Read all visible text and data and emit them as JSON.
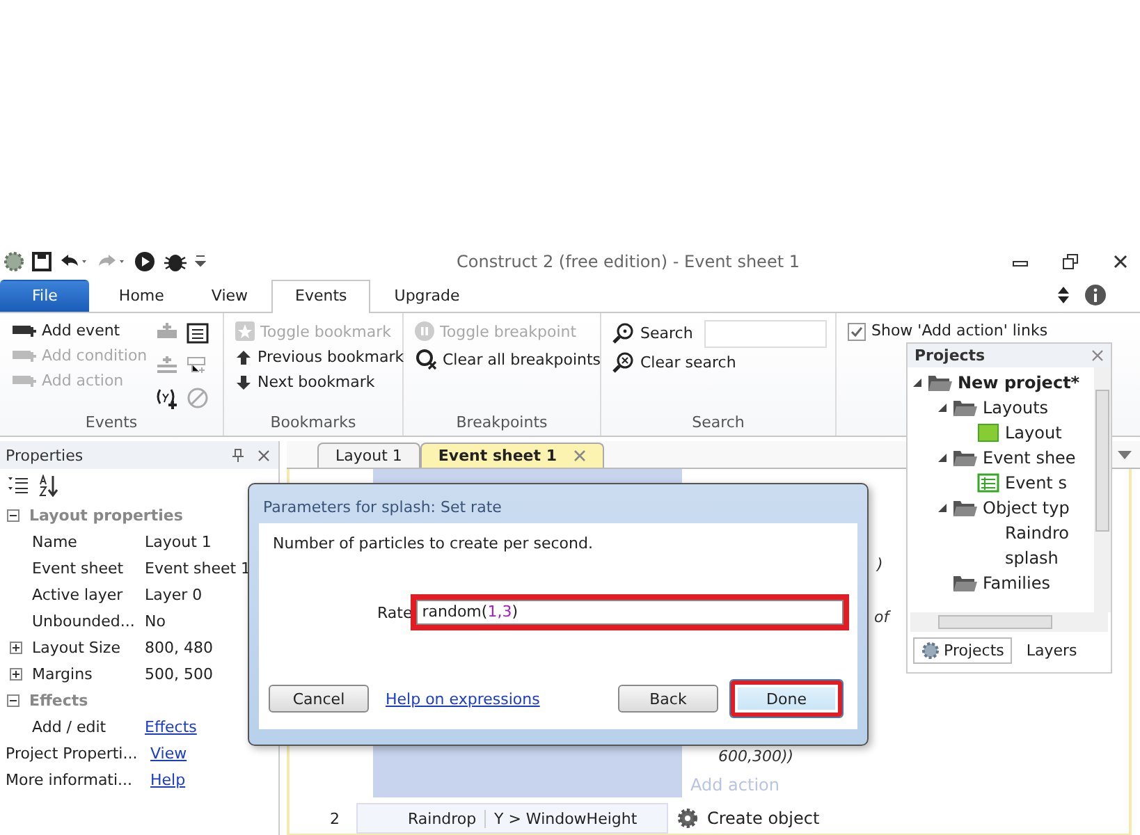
{
  "window": {
    "title": "Construct 2  (free edition) - Event sheet 1"
  },
  "ribbon_tabs": [
    {
      "label": "File",
      "kind": "file",
      "selected": false
    },
    {
      "label": "Home",
      "kind": "tab",
      "selected": false
    },
    {
      "label": "View",
      "kind": "tab",
      "selected": false
    },
    {
      "label": "Events",
      "kind": "tab",
      "selected": true
    },
    {
      "label": "Upgrade",
      "kind": "tab",
      "selected": false
    }
  ],
  "ribbon_groups": [
    {
      "label": "Events",
      "items": [
        {
          "label": "Add event",
          "disabled": false
        },
        {
          "label": "Add condition",
          "disabled": true
        },
        {
          "label": "Add action",
          "disabled": true
        }
      ]
    },
    {
      "label": "Bookmarks",
      "items": [
        {
          "label": "Toggle bookmark",
          "disabled": true
        },
        {
          "label": "Previous bookmark",
          "disabled": false
        },
        {
          "label": "Next bookmark",
          "disabled": false
        }
      ]
    },
    {
      "label": "Breakpoints",
      "items": [
        {
          "label": "Toggle breakpoint",
          "disabled": true
        },
        {
          "label": "Clear all breakpoints",
          "disabled": false
        }
      ]
    },
    {
      "label": "Search",
      "items": [
        {
          "label": "Search",
          "disabled": false
        },
        {
          "label": "Clear search",
          "disabled": false
        }
      ]
    }
  ],
  "show_add_action_links": {
    "label": "Show 'Add action' links",
    "checked": true
  },
  "properties": {
    "title": "Properties",
    "sections": [
      {
        "label": "Layout properties",
        "expanded": true,
        "rows": [
          {
            "name": "Name",
            "value": "Layout 1",
            "kind": "plain"
          },
          {
            "name": "Event sheet",
            "value": "Event sheet 1",
            "kind": "plain"
          },
          {
            "name": "Active layer",
            "value": "Layer 0",
            "kind": "plain"
          },
          {
            "name": "Unbounded...",
            "value": "No",
            "kind": "plain"
          },
          {
            "name": "Layout Size",
            "value": "800, 480",
            "kind": "expandable"
          },
          {
            "name": "Margins",
            "value": "500, 500",
            "kind": "expandable"
          }
        ]
      },
      {
        "label": "Effects",
        "expanded": true,
        "rows": [
          {
            "name": "Add / edit",
            "value": "Effects",
            "kind": "link"
          }
        ]
      }
    ],
    "footer_rows": [
      {
        "name": "Project Properti...",
        "value": "View",
        "kind": "link"
      },
      {
        "name": "More informati...",
        "value": "Help",
        "kind": "link"
      }
    ]
  },
  "editor_tabs": [
    {
      "label": "Layout 1",
      "selected": false
    },
    {
      "label": "Event sheet 1",
      "selected": true
    }
  ],
  "event_sheet": {
    "action_fragments": [
      ")",
      "of",
      "600,300))"
    ],
    "add_action": "Add action",
    "event_2": {
      "number": "2",
      "object": "Raindrop",
      "condition": "Y > WindowHeight",
      "action": "Create object"
    }
  },
  "dialog": {
    "title": "Parameters for splash: Set rate",
    "description": "Number of particles to create per second.",
    "param_label": "Rate",
    "value": [
      {
        "text": "random(",
        "kind": "plain"
      },
      {
        "text": "1,3",
        "kind": "number"
      },
      {
        "text": ")",
        "kind": "plain"
      }
    ],
    "field_highlighted": true,
    "help_link": "Help on expressions",
    "buttons": [
      {
        "label": "Cancel",
        "highlighted": false
      },
      {
        "label": "Back",
        "highlighted": false
      },
      {
        "label": "Done",
        "highlighted": true
      }
    ]
  },
  "projects": {
    "title": "Projects",
    "tree": [
      {
        "label": "New project*",
        "kind": "folder",
        "bold": true,
        "expanded": true,
        "children": [
          {
            "label": "Layouts",
            "kind": "folder",
            "bold": false,
            "expanded": true,
            "children": [
              {
                "label": "Layout",
                "kind": "layout",
                "bold": false
              }
            ]
          },
          {
            "label": "Event shee",
            "kind": "folder",
            "bold": false,
            "expanded": true,
            "children": [
              {
                "label": "Event s",
                "kind": "sheet",
                "bold": false
              }
            ]
          },
          {
            "label": "Object typ",
            "kind": "folder",
            "bold": false,
            "expanded": true,
            "children": [
              {
                "label": "Raindro",
                "kind": "object",
                "bold": false
              },
              {
                "label": "splash",
                "kind": "object",
                "bold": false
              }
            ]
          },
          {
            "label": "Families",
            "kind": "folder",
            "bold": false,
            "expanded": false
          }
        ]
      }
    ],
    "tabs": [
      {
        "label": "Projects",
        "selected": true
      },
      {
        "label": "Layers",
        "selected": false
      }
    ]
  }
}
